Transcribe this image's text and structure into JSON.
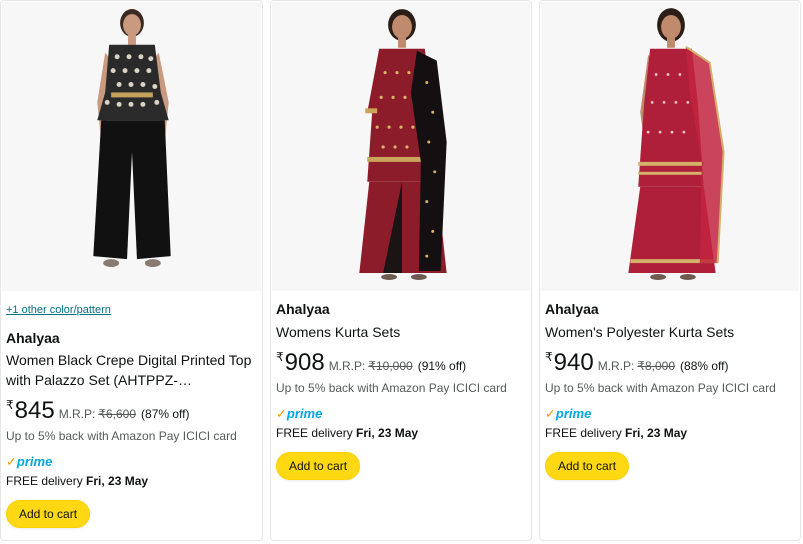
{
  "products": [
    {
      "swatch_link": "+1 other color/pattern",
      "brand": "Ahalyaa",
      "title": "Women Black Crepe Digital Printed Top with Palazzo Set (AHTPPZ-…",
      "currency": "₹",
      "price": "845",
      "mrp_label": "M.R.P:",
      "mrp": "₹6,600",
      "discount": "(87% off)",
      "cashback": "Up to 5% back with Amazon Pay ICICI card",
      "prime_check": "✓",
      "prime_word": "prime",
      "delivery_prefix": "FREE delivery",
      "delivery_date": "Fri, 23 May",
      "add_to_cart": "Add to cart",
      "image_icon": "model-black-top-palazzo-image"
    },
    {
      "brand": "Ahalyaa",
      "title": "Womens Kurta Sets",
      "currency": "₹",
      "price": "908",
      "mrp_label": "M.R.P:",
      "mrp": "₹10,000",
      "discount": "(91% off)",
      "cashback": "Up to 5% back with Amazon Pay ICICI card",
      "prime_check": "✓",
      "prime_word": "prime",
      "delivery_prefix": "FREE delivery",
      "delivery_date": "Fri, 23 May",
      "add_to_cart": "Add to cart",
      "image_icon": "model-red-kurta-black-dupatta-image"
    },
    {
      "brand": "Ahalyaa",
      "title": "Women's Polyester Kurta Sets",
      "currency": "₹",
      "price": "940",
      "mrp_label": "M.R.P:",
      "mrp": "₹8,000",
      "discount": "(88% off)",
      "cashback": "Up to 5% back with Amazon Pay ICICI card",
      "prime_check": "✓",
      "prime_word": "prime",
      "delivery_prefix": "FREE delivery",
      "delivery_date": "Fri, 23 May",
      "add_to_cart": "Add to cart",
      "image_icon": "model-maroon-sharara-set-image"
    }
  ],
  "colors": {
    "link": "#007185",
    "button": "#ffd814",
    "prime_check": "#ff9900",
    "prime_word": "#00a8e1",
    "muted_text": "#565959"
  }
}
